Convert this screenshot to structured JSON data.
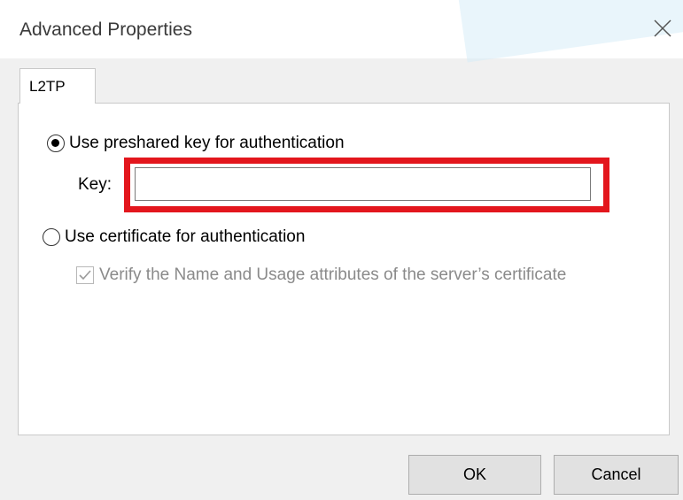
{
  "window": {
    "title": "Advanced Properties",
    "close_icon": "close-icon"
  },
  "tabs": [
    {
      "label": "L2TP",
      "selected": true
    }
  ],
  "auth": {
    "preshared_label": "Use preshared key for authentication",
    "preshared_selected": true,
    "key_label": "Key:",
    "key_value": "",
    "key_highlight_color": "#e3161d",
    "certificate_label": "Use certificate for authentication",
    "certificate_selected": false,
    "verify_label": "Verify the Name and Usage attributes of the server’s certificate",
    "verify_checked": true,
    "verify_disabled": true
  },
  "buttons": {
    "ok_label": "OK",
    "cancel_label": "Cancel"
  }
}
